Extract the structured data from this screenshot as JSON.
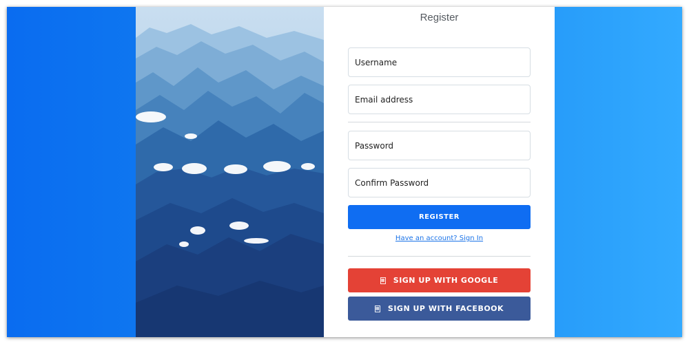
{
  "register": {
    "title": "Register",
    "fields": {
      "username": {
        "placeholder": "Username",
        "value": ""
      },
      "email": {
        "placeholder": "Email address",
        "value": ""
      },
      "password": {
        "placeholder": "Password",
        "value": ""
      },
      "confirm_password": {
        "placeholder": "Confirm Password",
        "value": ""
      }
    },
    "register_button": "REGISTER",
    "signin_link": "Have an account? Sign In",
    "google_button": "SIGN UP WITH GOOGLE",
    "facebook_button": "SIGN UP WITH FACEBOOK"
  },
  "icons": {
    "google": "google-icon",
    "facebook": "facebook-icon"
  },
  "colors": {
    "background_left": "#0a6cf0",
    "background_right": "#33aaff",
    "primary": "#0f6df2",
    "google": "#e44236",
    "facebook": "#3b5a9a",
    "link": "#1a73e8"
  }
}
